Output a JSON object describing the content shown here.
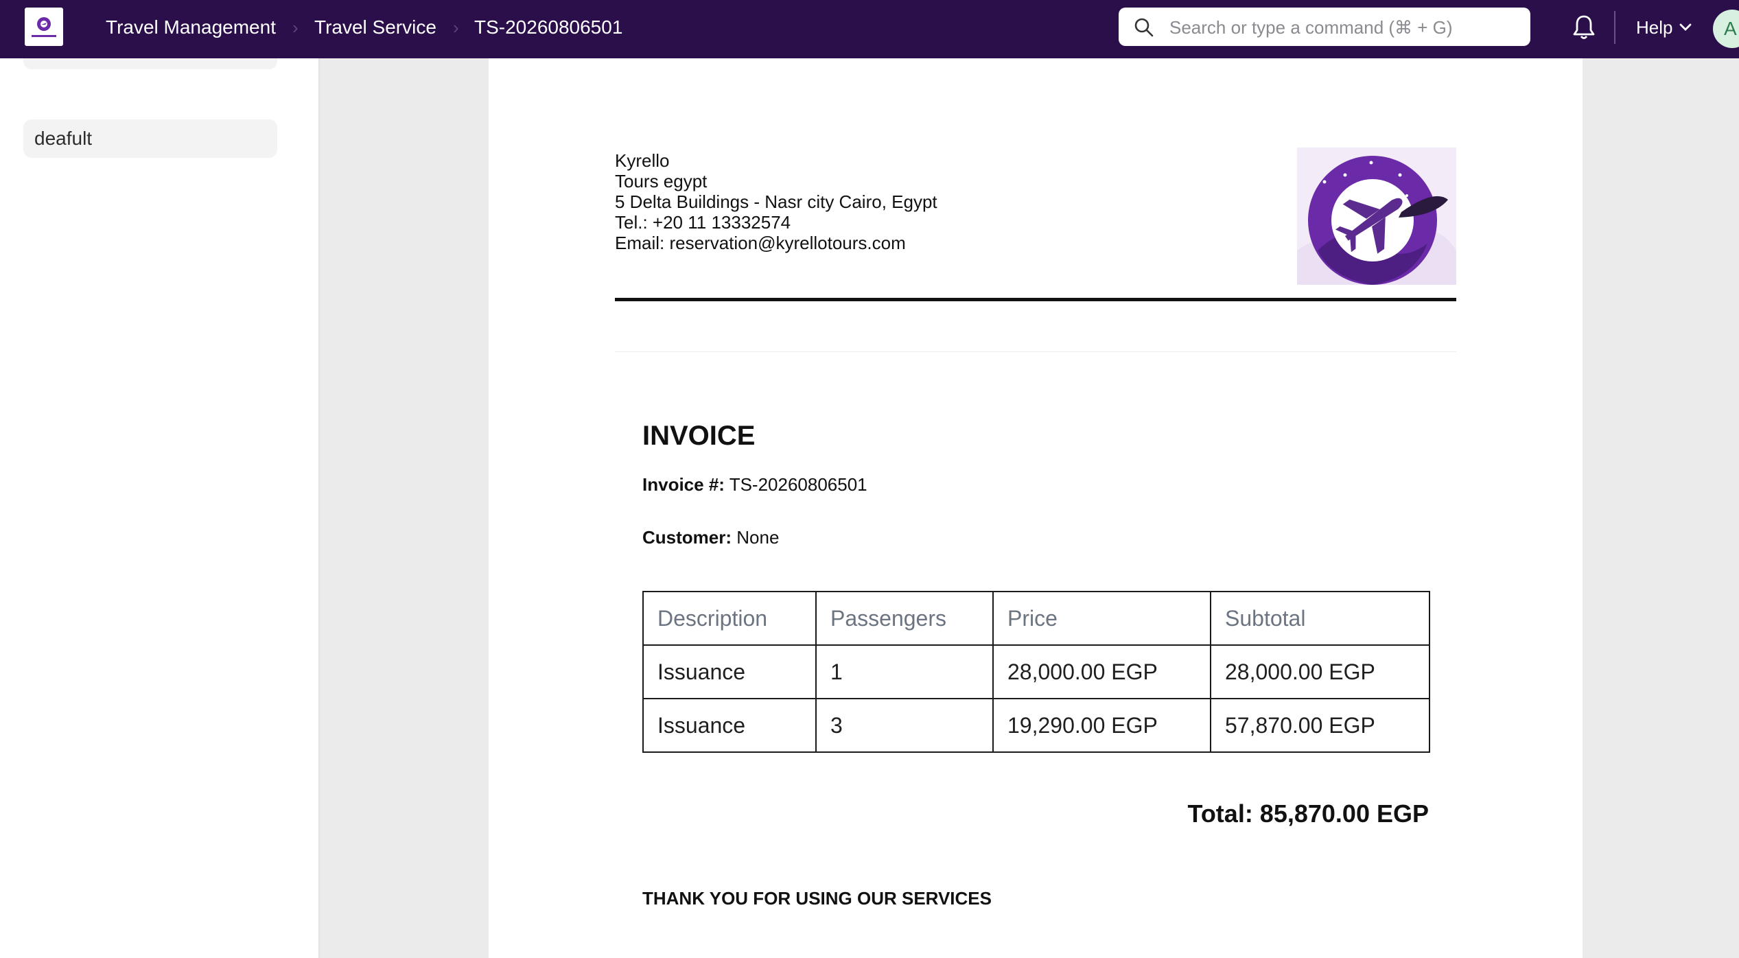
{
  "colors": {
    "navbar": "#2b0f4b",
    "brand_purple": "#6b2aa8",
    "page_background": "#ebebeb"
  },
  "navbar": {
    "logo_icon": "kyrello-tours-logo",
    "logo_text": "Kyrello Tours",
    "breadcrumbs": [
      "Travel Management",
      "Travel Service",
      "TS-20260806501"
    ],
    "search_placeholder": "Search or type a command (⌘ + G)",
    "notifications_icon": "bell-icon",
    "help_label": "Help",
    "avatar_initial": "A"
  },
  "sidebar": {
    "items": [
      {
        "label": "deafult"
      }
    ]
  },
  "invoice": {
    "company": {
      "name": "Kyrello",
      "subtitle": "Tours egypt",
      "address": "5 Delta Buildings - Nasr city Cairo, Egypt",
      "tel": "Tel.: +20 11 13332574",
      "email": "Email: reservation@kyrellotours.com"
    },
    "title": "INVOICE",
    "number_label": "Invoice #:",
    "number": "TS-20260806501",
    "customer_label": "Customer:",
    "customer": "None",
    "table": {
      "headers": [
        "Description",
        "Passengers",
        "Price",
        "Subtotal"
      ],
      "rows": [
        [
          "Issuance",
          "1",
          "28,000.00 EGP",
          "28,000.00 EGP"
        ],
        [
          "Issuance",
          "3",
          "19,290.00 EGP",
          "57,870.00 EGP"
        ]
      ]
    },
    "total": "Total: 85,870.00 EGP",
    "thank_you": "THANK YOU FOR USING OUR SERVICES"
  }
}
